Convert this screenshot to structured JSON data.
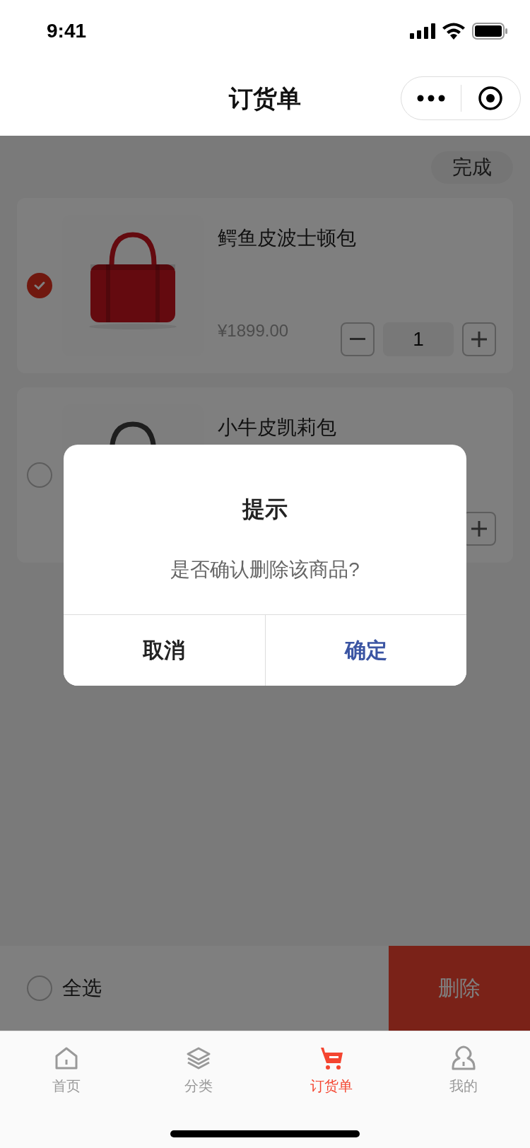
{
  "status_bar": {
    "time": "9:41"
  },
  "nav": {
    "title": "订货单"
  },
  "toolbar": {
    "done_label": "完成"
  },
  "items": [
    {
      "name": "鳄鱼皮波士顿包",
      "checked": true,
      "price": "¥1899.00",
      "quantity": "1"
    },
    {
      "name": "小牛皮凯莉包",
      "checked": false
    }
  ],
  "bottom_bar": {
    "select_all": {
      "label": "全选",
      "checked": false
    },
    "delete_label": "删除"
  },
  "dialog": {
    "title": "提示",
    "message": "是否确认删除该商品?",
    "buttons": [
      {
        "label": "取消",
        "kind": "cancel"
      },
      {
        "label": "确定",
        "kind": "confirm"
      }
    ]
  },
  "tabs": [
    {
      "label": "首页",
      "kind": "home",
      "selected": false
    },
    {
      "label": "分类",
      "kind": "layers",
      "selected": false
    },
    {
      "label": "订货单",
      "kind": "cart",
      "selected": true
    },
    {
      "label": "我的",
      "kind": "user",
      "selected": false
    }
  ]
}
